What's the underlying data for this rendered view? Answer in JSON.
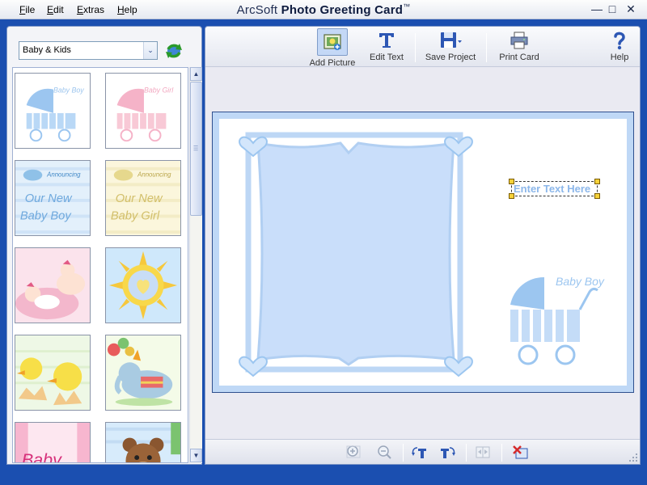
{
  "menu": [
    "File",
    "Edit",
    "Extras",
    "Help"
  ],
  "title": {
    "brand": "ArcSoft",
    "product": "Photo Greeting Card",
    "tm": "™"
  },
  "window_controls": {
    "minimize": "—",
    "maximize": "□",
    "close": "✕"
  },
  "category": {
    "selected": "Baby & Kids",
    "arrow": "⌄"
  },
  "scrollbar": {
    "up": "▲",
    "down": "▼"
  },
  "thumbnails": [
    {
      "label": "Baby Boy",
      "text": "Baby Boy",
      "theme": "boy-carriage"
    },
    {
      "label": "Baby Girl",
      "text": "Baby Girl",
      "theme": "girl-carriage"
    },
    {
      "label": "Announcing Our New Baby Boy",
      "text1": "Announcing",
      "text2": "Our New",
      "text3": "Baby Boy",
      "theme": "announce-boy"
    },
    {
      "label": "Announcing Our New Baby Girl",
      "text1": "Announcing",
      "text2": "Our New",
      "text3": "Baby Girl",
      "theme": "announce-girl"
    },
    {
      "label": "Sleeping babies",
      "theme": "babies"
    },
    {
      "label": "Sun",
      "theme": "sun"
    },
    {
      "label": "Chicks",
      "theme": "chicks"
    },
    {
      "label": "Elephant",
      "theme": "elephant"
    },
    {
      "label": "Baby",
      "text": "Baby",
      "theme": "pink-baby"
    },
    {
      "label": "Teddy bear",
      "theme": "teddy"
    }
  ],
  "toolbar": {
    "add_picture": "Add Picture",
    "edit_text": "Edit Text",
    "save_project": "Save Project",
    "print_card": "Print Card",
    "help": "Help"
  },
  "card": {
    "placeholder_text": "Enter Text Here",
    "stamp_text": "Baby Boy"
  },
  "colors": {
    "frame_blue": "#bdd7f5",
    "frame_light": "#d7e7fb",
    "carriage_blue": "#9cc6f0",
    "accent_text": "#8cb7ea"
  }
}
